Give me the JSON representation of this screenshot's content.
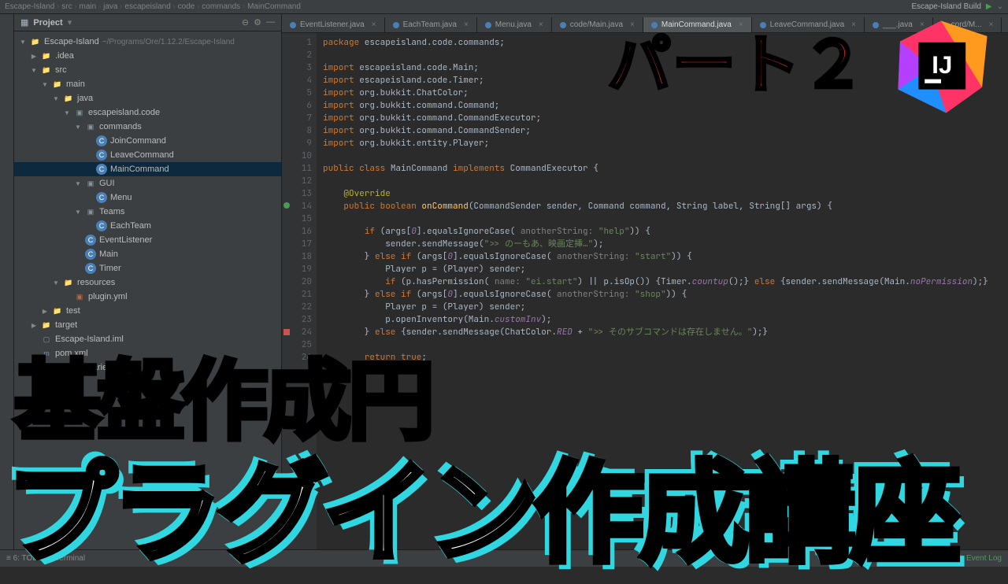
{
  "breadcrumb": [
    "Escape-Island",
    "src",
    "main",
    "java",
    "escapeisland",
    "code",
    "commands",
    "MainCommand"
  ],
  "build_label": "Escape-Island Build",
  "project_panel": {
    "title": "Project",
    "root": "Escape-Island",
    "root_path": "~/Programs/Ore/1.12.2/Escape-Island"
  },
  "tree": [
    {
      "depth": 0,
      "arrow": "▼",
      "icon": "folder",
      "label": "Escape-Island",
      "path": "~/Programs/Ore/1.12.2/Escape-Island"
    },
    {
      "depth": 1,
      "arrow": "▶",
      "icon": "folder",
      "label": ".idea"
    },
    {
      "depth": 1,
      "arrow": "▼",
      "icon": "folder",
      "label": "src"
    },
    {
      "depth": 2,
      "arrow": "▼",
      "icon": "folder",
      "label": "main"
    },
    {
      "depth": 3,
      "arrow": "▼",
      "icon": "folder",
      "label": "java"
    },
    {
      "depth": 4,
      "arrow": "▼",
      "icon": "pkg",
      "label": "escapeisland.code"
    },
    {
      "depth": 5,
      "arrow": "▼",
      "icon": "pkg",
      "label": "commands"
    },
    {
      "depth": 6,
      "arrow": "",
      "icon": "class",
      "label": "JoinCommand"
    },
    {
      "depth": 6,
      "arrow": "",
      "icon": "class",
      "label": "LeaveCommand"
    },
    {
      "depth": 6,
      "arrow": "",
      "icon": "class",
      "label": "MainCommand",
      "selected": true
    },
    {
      "depth": 5,
      "arrow": "▼",
      "icon": "pkg",
      "label": "GUI"
    },
    {
      "depth": 6,
      "arrow": "",
      "icon": "class",
      "label": "Menu"
    },
    {
      "depth": 5,
      "arrow": "▼",
      "icon": "pkg",
      "label": "Teams"
    },
    {
      "depth": 6,
      "arrow": "",
      "icon": "class",
      "label": "EachTeam"
    },
    {
      "depth": 5,
      "arrow": "",
      "icon": "class",
      "label": "EventListener"
    },
    {
      "depth": 5,
      "arrow": "",
      "icon": "class",
      "label": "Main"
    },
    {
      "depth": 5,
      "arrow": "",
      "icon": "class",
      "label": "Timer"
    },
    {
      "depth": 3,
      "arrow": "▼",
      "icon": "folder",
      "label": "resources"
    },
    {
      "depth": 4,
      "arrow": "",
      "icon": "yml",
      "label": "plugin.yml"
    },
    {
      "depth": 2,
      "arrow": "▶",
      "icon": "folder",
      "label": "test"
    },
    {
      "depth": 1,
      "arrow": "▶",
      "icon": "folder",
      "label": "target"
    },
    {
      "depth": 1,
      "arrow": "",
      "icon": "file",
      "label": "Escape-Island.iml"
    },
    {
      "depth": 1,
      "arrow": "",
      "icon": "xml",
      "label": "pom.xml"
    },
    {
      "depth": 0,
      "arrow": "▶",
      "icon": "lib",
      "label": "External Libraries"
    }
  ],
  "tabs": [
    {
      "label": "EventListener.java"
    },
    {
      "label": "EachTeam.java"
    },
    {
      "label": "Menu.java"
    },
    {
      "label": "code/Main.java"
    },
    {
      "label": "MainCommand.java",
      "active": true
    },
    {
      "label": "LeaveCommand.java"
    },
    {
      "label": "___.java"
    },
    {
      "label": "cord/M..."
    }
  ],
  "code_lines": [
    {
      "n": 1,
      "html": "<span class='kw'>package</span> escapeisland.code.commands;"
    },
    {
      "n": 2,
      "html": ""
    },
    {
      "n": 3,
      "html": "<span class='kw'>import</span> escapeisland.code.Main;"
    },
    {
      "n": 4,
      "html": "<span class='kw'>import</span> escapeisland.code.Timer;"
    },
    {
      "n": 5,
      "html": "<span class='kw'>import</span> org.bukkit.ChatColor;"
    },
    {
      "n": 6,
      "html": "<span class='kw'>import</span> org.bukkit.command.Command;"
    },
    {
      "n": 7,
      "html": "<span class='kw'>import</span> org.bukkit.command.CommandExecutor;"
    },
    {
      "n": 8,
      "html": "<span class='kw'>import</span> org.bukkit.command.CommandSender;"
    },
    {
      "n": 9,
      "html": "<span class='kw'>import</span> org.bukkit.entity.Player;"
    },
    {
      "n": 10,
      "html": ""
    },
    {
      "n": 11,
      "html": "<span class='kw'>public class</span> <span class='typ'>MainCommand</span> <span class='kw'>implements</span> CommandExecutor {"
    },
    {
      "n": 12,
      "html": ""
    },
    {
      "n": 13,
      "html": "    <span class='ann'>@Override</span>"
    },
    {
      "n": 14,
      "mark": "green",
      "html": "    <span class='kw'>public boolean</span> <span class='fn'>onCommand</span>(CommandSender sender, Command command, String label, String[] args) {"
    },
    {
      "n": 15,
      "html": ""
    },
    {
      "n": 16,
      "html": "        <span class='kw'>if</span> (args[<span class='fld'>0</span>].equalsIgnoreCase( <span class='cmt'>anotherString:</span> <span class='str'>\"help\"</span>)) {"
    },
    {
      "n": 17,
      "html": "            sender.sendMessage(<span class='str'>\">> のーもあ、映画定挿…\"</span>);"
    },
    {
      "n": 18,
      "html": "        } <span class='kw'>else if</span> (args[<span class='fld'>0</span>].equalsIgnoreCase( <span class='cmt'>anotherString:</span> <span class='str'>\"start\"</span>)) {"
    },
    {
      "n": 19,
      "html": "            Player p = (Player) sender;"
    },
    {
      "n": 20,
      "html": "            <span class='kw'>if</span> (p.hasPermission( <span class='cmt'>name:</span> <span class='str'>\"ei.start\"</span>) || p.isOp()) {Timer.<span class='fld'>countup</span>();} <span class='kw'>else</span> {sender.sendMessage(Main.<span class='fld'>noPermission</span>);}"
    },
    {
      "n": 21,
      "html": "        } <span class='kw'>else if</span> (args[<span class='fld'>0</span>].equalsIgnoreCase( <span class='cmt'>anotherString:</span> <span class='str'>\"shop\"</span>)) {"
    },
    {
      "n": 22,
      "html": "            Player p = (Player) sender;"
    },
    {
      "n": 23,
      "html": "            p.openInventory(Main.<span class='fld'>customInv</span>);"
    },
    {
      "n": 24,
      "mark": "red",
      "html": "        } <span class='kw'>else</span> {sender.sendMessage(ChatColor.<span class='fld'>RED</span> + <span class='str'>\">> そのサブコマンドは存在しません。\"</span>);}"
    },
    {
      "n": 25,
      "html": ""
    },
    {
      "n": 26,
      "html": "        <span class='kw'>return true</span>;"
    }
  ],
  "bottom": {
    "todo": "≡ 6: TODO",
    "terminal": "Terminal",
    "event_log": "Event Log"
  },
  "overlay": {
    "part2": "パート２",
    "green": "基盤作成円",
    "white": "プラグイン作成講座",
    "ij": "IJ"
  }
}
